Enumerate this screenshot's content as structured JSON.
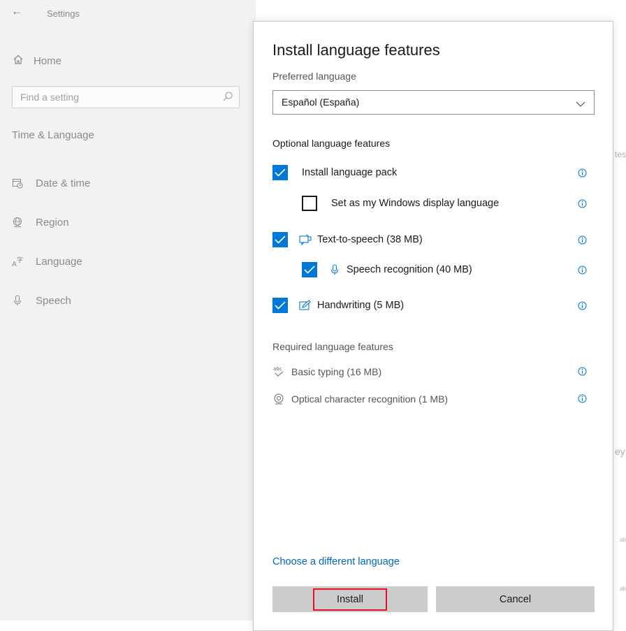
{
  "settings": {
    "title": "Settings",
    "home_label": "Home",
    "search_placeholder": "Find a setting",
    "section_title": "Time & Language",
    "nav_items": [
      {
        "label": "Date & time",
        "icon": "calendar-clock-icon"
      },
      {
        "label": "Region",
        "icon": "globe-region-icon"
      },
      {
        "label": "Language",
        "icon": "language-icon"
      },
      {
        "label": "Speech",
        "icon": "microphone-icon"
      }
    ]
  },
  "background_fragments": {
    "frag1": "tes",
    "frag2": "ey",
    "frag3": "ab",
    "frag4": "ab"
  },
  "dialog": {
    "title": "Install language features",
    "preferred_label": "Preferred language",
    "preferred_value": "Español (España)",
    "optional_heading": "Optional language features",
    "optional_features": [
      {
        "label": "Install language pack",
        "checked": true,
        "icon": null
      },
      {
        "label": "Set as my Windows display language",
        "checked": false,
        "icon": null
      },
      {
        "label": "Text-to-speech (38 MB)",
        "checked": true,
        "icon": "text-to-speech-icon"
      },
      {
        "label": "Speech recognition (40 MB)",
        "checked": true,
        "icon": "microphone-icon"
      },
      {
        "label": "Handwriting (5 MB)",
        "checked": true,
        "icon": "handwriting-icon"
      }
    ],
    "required_heading": "Required language features",
    "required_features": [
      {
        "label": "Basic typing (16 MB)",
        "icon": "basic-typing-icon"
      },
      {
        "label": "Optical character recognition (1 MB)",
        "icon": "ocr-icon"
      }
    ],
    "change_language_link": "Choose a different language",
    "install_button": "Install",
    "cancel_button": "Cancel"
  },
  "colors": {
    "accent": "#0078d7",
    "link": "#0067c0",
    "highlight_border": "#e81123",
    "button_bg": "#cccccc"
  }
}
